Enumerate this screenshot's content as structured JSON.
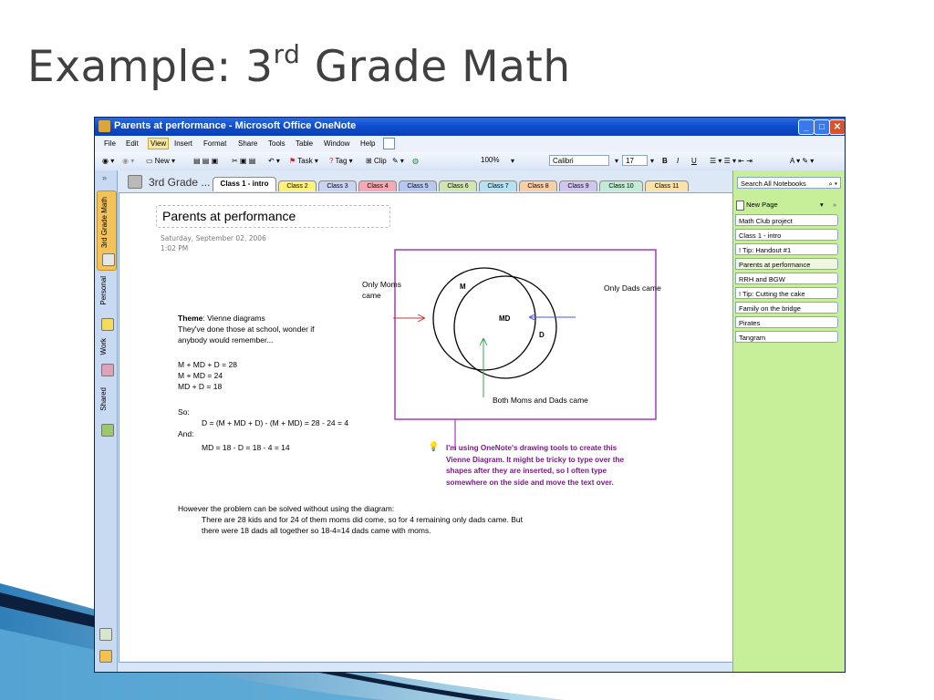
{
  "slide": {
    "title_main": "Example: 3",
    "title_sup": "rd",
    "title_end": " Grade Math"
  },
  "window": {
    "title": "Parents at performance - Microsoft Office OneNote",
    "minimize": "_",
    "maximize": "□",
    "close": "✕"
  },
  "menu": [
    "File",
    "Edit",
    "View",
    "Insert",
    "Format",
    "Share",
    "Tools",
    "Table",
    "Window",
    "Help"
  ],
  "toolbar": {
    "new_label": "New",
    "task_label": "Task",
    "tag_label": "Tag",
    "clip_label": "Clip",
    "zoom": "100%",
    "font": "Calibri",
    "size": "17",
    "bold": "B",
    "italic": "I",
    "underline": "U"
  },
  "nav": {
    "notebooks": [
      "3rd Grade Math",
      "Personal",
      "Work",
      "Shared"
    ],
    "collapse": "»"
  },
  "notebook_name": "3rd Grade ...",
  "sections": [
    {
      "label": "Class 1 - intro",
      "color": "#ffffff",
      "active": true
    },
    {
      "label": "Class 2",
      "color": "#fff27a"
    },
    {
      "label": "Class 3",
      "color": "#c9d4f2"
    },
    {
      "label": "Class 4",
      "color": "#f6a9b4"
    },
    {
      "label": "Class 5",
      "color": "#b7c9f0"
    },
    {
      "label": "Class 6",
      "color": "#cfe6b0"
    },
    {
      "label": "Class 7",
      "color": "#b6e2ef"
    },
    {
      "label": "Class 8",
      "color": "#f9cfa8"
    },
    {
      "label": "Class 9",
      "color": "#d3c6ee"
    },
    {
      "label": "Class 10",
      "color": "#c2ebd3"
    },
    {
      "label": "Class 11",
      "color": "#fbe2a6"
    }
  ],
  "page": {
    "title": "Parents at performance",
    "date": "Saturday, September 02, 2006",
    "time": "1:02 PM"
  },
  "notes": {
    "theme_label": "Theme",
    "theme_rest": ": Vienne diagrams",
    "line2": "They've done those at school, wonder if",
    "line3": "anybody would remember...",
    "eq1": "M + MD + D = 28",
    "eq2": "M + MD = 24",
    "eq3": "MD + D = 18",
    "so": "So:",
    "d_eq": "D = (M + MD + D) - (M + MD) = 28 - 24 = 4",
    "and": "And:",
    "md_eq": "MD = 18  - D = 18  - 4 = 14",
    "however": "However the problem can be solved without using the diagram:",
    "expl1": "There are 28 kids and for 24 of them moms did come, so for 4 remaining only dads came. But",
    "expl2": "there were 18 dads all together so 18-4=14 dads came with moms."
  },
  "venn": {
    "only_moms_1": "Only Moms",
    "only_moms_2": "came",
    "only_dads": "Only Dads came",
    "both": "Both Moms and Dads came",
    "m": "M",
    "md": "MD",
    "d": "D",
    "frame_color": "#a63ab5",
    "arrow_red": "#c23a3a",
    "arrow_blue": "#4a5bd6",
    "arrow_green": "#3aa54a"
  },
  "tip": [
    "I'm using OneNote's drawing tools to create this",
    "Vienne Diagram. It might be tricky to type over the",
    "shapes after they are inserted, so I often type",
    "somewhere on the side and move the text over."
  ],
  "pages_panel": {
    "search": "Search All Notebooks",
    "new_page": "New Page",
    "pages": [
      "Math Club project",
      "Class 1 - intro",
      "! Tip: Handout #1",
      "Parents at performance",
      "RRH and BGW",
      "! Tip: Cutting the cake",
      "Family on the bridge",
      "Pirates",
      "Tangram"
    ],
    "active_index": 3
  }
}
